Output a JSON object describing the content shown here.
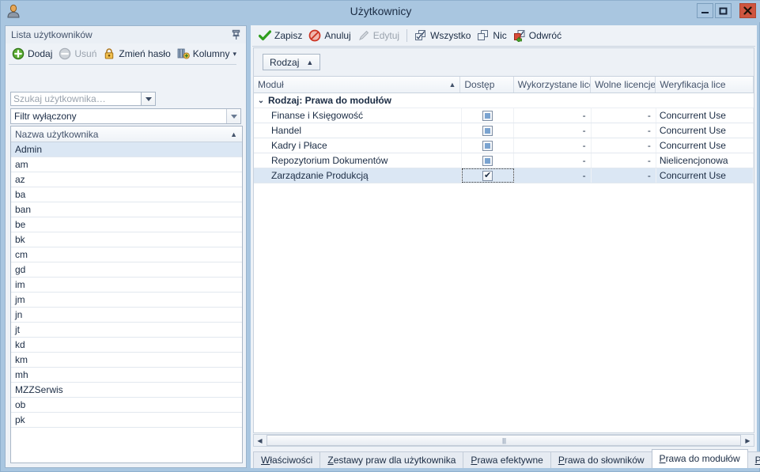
{
  "window": {
    "title": "Użytkownicy",
    "icon": "user-icon",
    "controls": {
      "minimize": "minimize-icon",
      "maximize": "maximize-icon",
      "close": "close-icon"
    },
    "accent_titlebar": "#a9c6e0",
    "accent_close": "#cf553f"
  },
  "left_panel": {
    "header_title": "Lista użytkowników",
    "pin_icon": "pin-icon",
    "toolbar": [
      {
        "label": "Dodaj",
        "icon": "plus-circle-icon",
        "disabled": false
      },
      {
        "label": "Usuń",
        "icon": "minus-circle-icon",
        "disabled": true
      },
      {
        "label": "Zmień hasło",
        "icon": "lock-icon",
        "disabled": false
      },
      {
        "label": "Kolumny",
        "icon": "columns-icon",
        "disabled": false,
        "caret": "▾"
      }
    ],
    "search": {
      "value": "",
      "placeholder": "Szukaj użytkownika…",
      "dropdown_icon": "chevron-down-icon"
    },
    "filter": {
      "value": "Filtr wyłączony",
      "dropdown_icon": "chevron-down-icon"
    },
    "grid": {
      "column_header": "Nazwa użytkownika",
      "sort_icon": "▲",
      "selected_index": 0,
      "rows": [
        "Admin",
        "am",
        "az",
        "ba",
        "ban",
        "be",
        "bk",
        "cm",
        "gd",
        "im",
        "jm",
        "jn",
        "jt",
        "kd",
        "km",
        "mh",
        "MZZSerwis",
        "ob",
        "pk"
      ]
    }
  },
  "right_panel": {
    "toolbar": [
      {
        "label": "Zapisz",
        "icon": "check-green-icon",
        "disabled": false
      },
      {
        "label": "Anuluj",
        "icon": "cancel-red-icon",
        "disabled": false
      },
      {
        "label": "Edytuj",
        "icon": "pencil-icon",
        "disabled": true
      },
      {
        "separator": true
      },
      {
        "label": "Wszystko",
        "icon": "select-all-icon",
        "disabled": false
      },
      {
        "label": "Nic",
        "icon": "select-none-icon",
        "disabled": false
      },
      {
        "label": "Odwróć",
        "icon": "invert-selection-icon",
        "disabled": false
      }
    ],
    "group_panel": {
      "chip_label": "Rodzaj",
      "chip_sort_icon": "▲"
    },
    "table": {
      "columns": [
        {
          "label": "Moduł",
          "sort_icon": "▲"
        },
        {
          "label": "Dostęp"
        },
        {
          "label": "Wykorzystane lice…"
        },
        {
          "label": "Wolne licencje"
        },
        {
          "label": "Weryfikacja lice"
        }
      ],
      "group_row": {
        "expander": "⌄",
        "label": "Rodzaj: Prawa do modułów"
      },
      "rows": [
        {
          "name": "Finanse i Księgowość",
          "access": "indeterminate",
          "used": "-",
          "free": "-",
          "verification": "Concurrent Use",
          "selected": false
        },
        {
          "name": "Handel",
          "access": "indeterminate",
          "used": "-",
          "free": "-",
          "verification": "Concurrent Use",
          "selected": false
        },
        {
          "name": "Kadry i Płace",
          "access": "indeterminate",
          "used": "-",
          "free": "-",
          "verification": "Concurrent Use",
          "selected": false
        },
        {
          "name": "Repozytorium Dokumentów",
          "access": "indeterminate",
          "used": "-",
          "free": "-",
          "verification": "Nielicencjonowa",
          "selected": false
        },
        {
          "name": "Zarządzanie Produkcją",
          "access": "checked",
          "used": "-",
          "free": "-",
          "verification": "Concurrent Use",
          "selected": true
        }
      ]
    },
    "hscrollbar": {
      "left_arrow": "◀",
      "right_arrow": "▶",
      "grip": "||||"
    },
    "tabs": {
      "items": [
        {
          "label": "Właściwości",
          "mnemonic": "W",
          "active": false
        },
        {
          "label": "Zestawy praw dla użytkownika",
          "mnemonic": "Z",
          "active": false
        },
        {
          "label": "Prawa efektywne",
          "mnemonic": "P",
          "active": false
        },
        {
          "label": "Prawa do słowników",
          "mnemonic": "P",
          "active": false
        },
        {
          "label": "Prawa do modułów",
          "mnemonic": "P",
          "active": true
        },
        {
          "label": "Prawa do",
          "mnemonic": "P",
          "active": false,
          "clipped": true
        }
      ],
      "nav_prev": "◀",
      "nav_next": "▶"
    }
  }
}
